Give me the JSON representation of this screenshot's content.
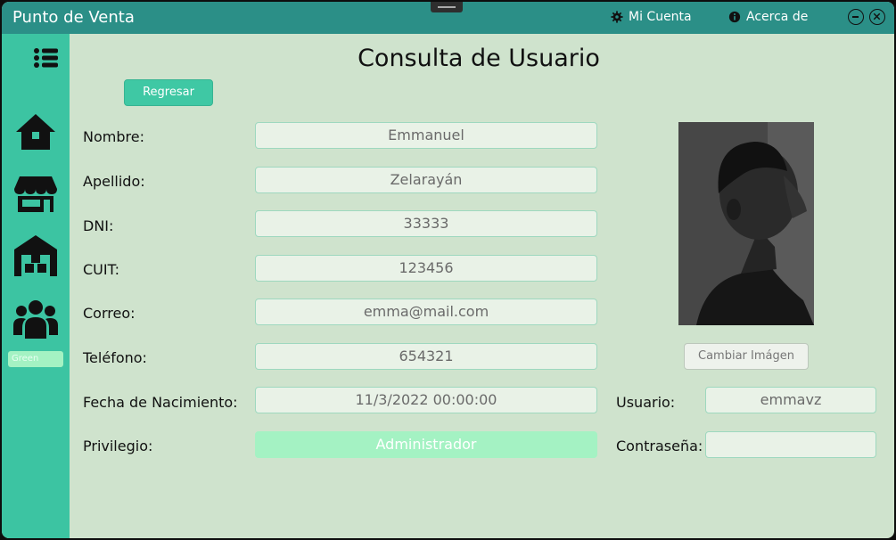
{
  "window": {
    "title": "Punto de Venta"
  },
  "titlebar": {
    "account_label": "Mi Cuenta",
    "account_icon": "gear-icon",
    "about_label": "Acerca de",
    "about_icon": "info-icon"
  },
  "sidebar": {
    "items": [
      {
        "icon": "menu-icon"
      },
      {
        "icon": "home-icon"
      },
      {
        "icon": "store-icon"
      },
      {
        "icon": "warehouse-icon"
      },
      {
        "icon": "users-icon"
      }
    ],
    "theme_label": "Green"
  },
  "page": {
    "title": "Consulta de Usuario",
    "back_button": "Regresar"
  },
  "form": {
    "nombre": {
      "label": "Nombre:",
      "value": "Emmanuel"
    },
    "apellido": {
      "label": "Apellido:",
      "value": "Zelarayán"
    },
    "dni": {
      "label": "DNI:",
      "value": "33333"
    },
    "cuit": {
      "label": "CUIT:",
      "value": "123456"
    },
    "correo": {
      "label": "Correo:",
      "value": "emma@mail.com"
    },
    "telefono": {
      "label": "Teléfono:",
      "value": "654321"
    },
    "fecha": {
      "label": "Fecha de Nacimiento:",
      "value": "11/3/2022 00:00:00"
    },
    "privilegio": {
      "label": "Privilegio:",
      "value": "Administrador"
    },
    "usuario": {
      "label": "Usuario:",
      "value": "emmavz"
    },
    "contrasena": {
      "label": "Contraseña:",
      "value": ""
    }
  },
  "photo": {
    "change_button": "Cambiar Imágen"
  },
  "colors": {
    "titlebar": "#2b8f87",
    "sidebar": "#3cc4a2",
    "content": "#cfe3cd",
    "accent_button": "#3fc8a4",
    "privilege_field": "#a4f2c3"
  }
}
